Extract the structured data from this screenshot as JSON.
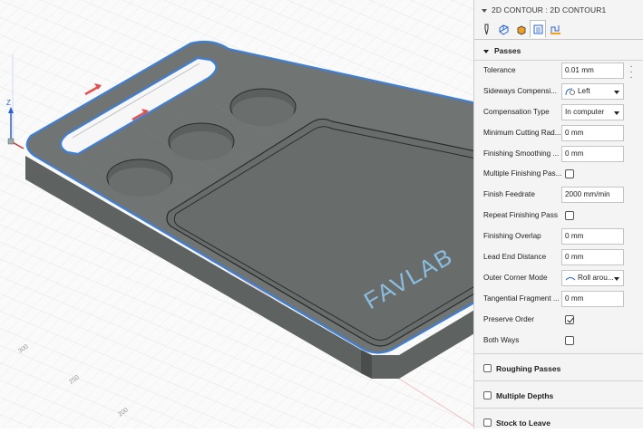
{
  "viewport": {
    "axis_label_z": "Z",
    "model_text": "FAVLAB",
    "grid_labels": [
      "200",
      "250",
      "300"
    ]
  },
  "panel": {
    "title": "2D CONTOUR : 2D CONTOUR1",
    "tabs": [
      {
        "icon": "tool-icon",
        "active": false
      },
      {
        "icon": "geometry-icon",
        "active": false
      },
      {
        "icon": "heights-icon",
        "active": false
      },
      {
        "icon": "passes-icon",
        "active": true
      },
      {
        "icon": "linking-icon",
        "active": false
      }
    ],
    "passes_header": "Passes",
    "fields": {
      "tolerance": {
        "label": "Tolerance",
        "value": "0.01 mm"
      },
      "sideways": {
        "label": "Sideways Compensi...",
        "value": "Left"
      },
      "comp_type": {
        "label": "Compensation Type",
        "value": "In computer"
      },
      "min_radius": {
        "label": "Minimum Cutting Rad...",
        "value": "0 mm"
      },
      "finishing_smoothing": {
        "label": "Finishing Smoothing ...",
        "value": "0 mm"
      },
      "multiple_finishing": {
        "label": "Multiple Finishing Pas...",
        "checked": false
      },
      "finish_feedrate": {
        "label": "Finish Feedrate",
        "value": "2000 mm/min"
      },
      "repeat_finishing": {
        "label": "Repeat Finishing Pass",
        "checked": false
      },
      "finishing_overlap": {
        "label": "Finishing Overlap",
        "value": "0 mm"
      },
      "lead_end": {
        "label": "Lead End Distance",
        "value": "0 mm"
      },
      "outer_corner": {
        "label": "Outer Corner Mode",
        "value": "Roll arou..."
      },
      "tangential_fragment": {
        "label": "Tangential Fragment ...",
        "value": "0 mm"
      },
      "preserve_order": {
        "label": "Preserve Order",
        "checked": true
      },
      "both_ways": {
        "label": "Both Ways",
        "checked": false
      }
    },
    "sections": {
      "roughing": "Roughing Passes",
      "multiple_depths": "Multiple Depths",
      "stock_to_leave": "Stock to Leave"
    }
  }
}
